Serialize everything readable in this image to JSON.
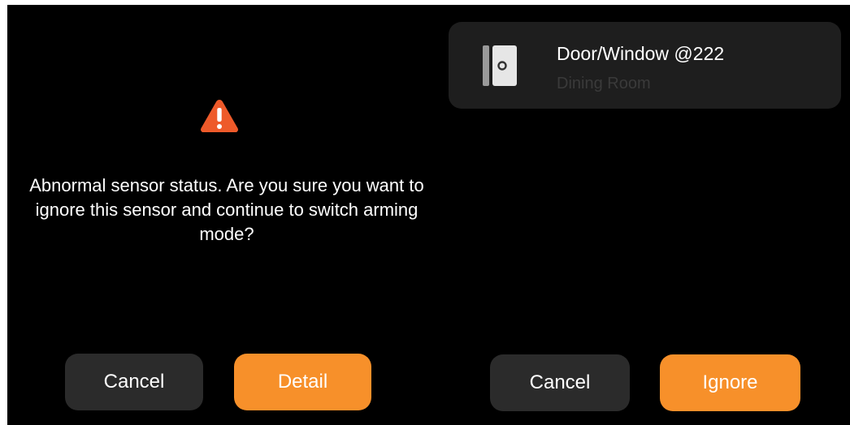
{
  "colors": {
    "screen_bg": "#000000",
    "button_dark": "#2b2b2b",
    "button_accent": "#f7902a",
    "card_bg": "#1e1e1e",
    "warning": "#ee5a2a"
  },
  "left_dialog": {
    "icon": "warning-triangle-icon",
    "message": "Abnormal sensor status. Are you sure you want to ignore this sensor and continue to switch arming mode?",
    "cancel_label": "Cancel",
    "detail_label": "Detail"
  },
  "right_dialog": {
    "sensor": {
      "icon": "door-window-sensor-icon",
      "name": "Door/Window @222",
      "room": "Dining Room"
    },
    "cancel_label": "Cancel",
    "ignore_label": "Ignore"
  }
}
